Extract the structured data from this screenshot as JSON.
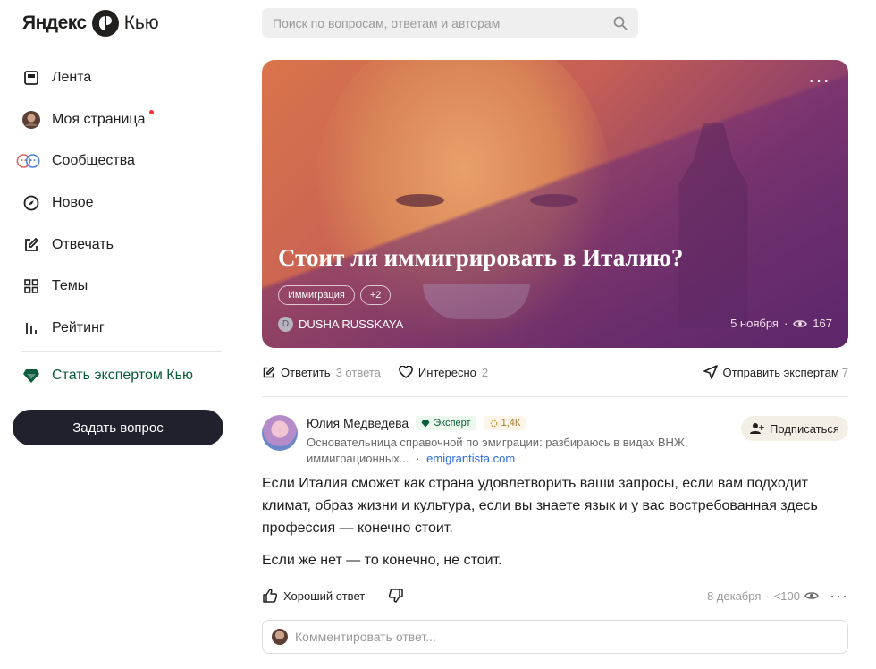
{
  "logo": {
    "yandex": "Яндекс",
    "kyu": "Кью"
  },
  "search": {
    "placeholder": "Поиск по вопросам, ответам и авторам"
  },
  "nav": {
    "items": [
      {
        "label": "Лента"
      },
      {
        "label": "Моя страница"
      },
      {
        "label": "Сообщества"
      },
      {
        "label": "Новое"
      },
      {
        "label": "Отвечать"
      },
      {
        "label": "Темы"
      },
      {
        "label": "Рейтинг"
      }
    ],
    "expert": "Стать экспертом Кью",
    "ask": "Задать вопрос"
  },
  "question": {
    "title": "Стоит ли иммигрировать в Италию?",
    "tags": [
      "Иммиграция",
      "+2"
    ],
    "author_initial": "D",
    "author": "DUSHA RUSSKAYA",
    "date": "5 ноября",
    "views": "167"
  },
  "actions": {
    "answer": "Ответить",
    "answer_count": "3 ответа",
    "interesting": "Интересно",
    "interesting_count": "2",
    "send": "Отправить экспертам",
    "send_count": "7"
  },
  "answer": {
    "author": "Юлия Медведева",
    "expert_badge": "Эксперт",
    "score": "1,4К",
    "bio": "Основательница справочной по эмиграции: разбираюсь в видах ВНЖ, иммиграционных...",
    "bio_sep": "·",
    "link": "emigrantista.com",
    "subscribe": "Подписаться",
    "paragraphs": [
      "Если Италия сможет как страна удовлетворить ваши запросы, если вам подходит климат, образ жизни и культура, если вы знаете язык и у вас востребованная здесь профессия — конечно стоит.",
      "Если же нет — то конечно, не стоит."
    ],
    "good": "Хороший ответ",
    "date": "8 декабря",
    "views": "<100"
  },
  "comment": {
    "placeholder": "Комментировать ответ..."
  },
  "colors": {
    "accent_green": "#0a5c3a",
    "button_dark": "#21202d",
    "link": "#2b6be0",
    "notify": "#ff3333"
  }
}
